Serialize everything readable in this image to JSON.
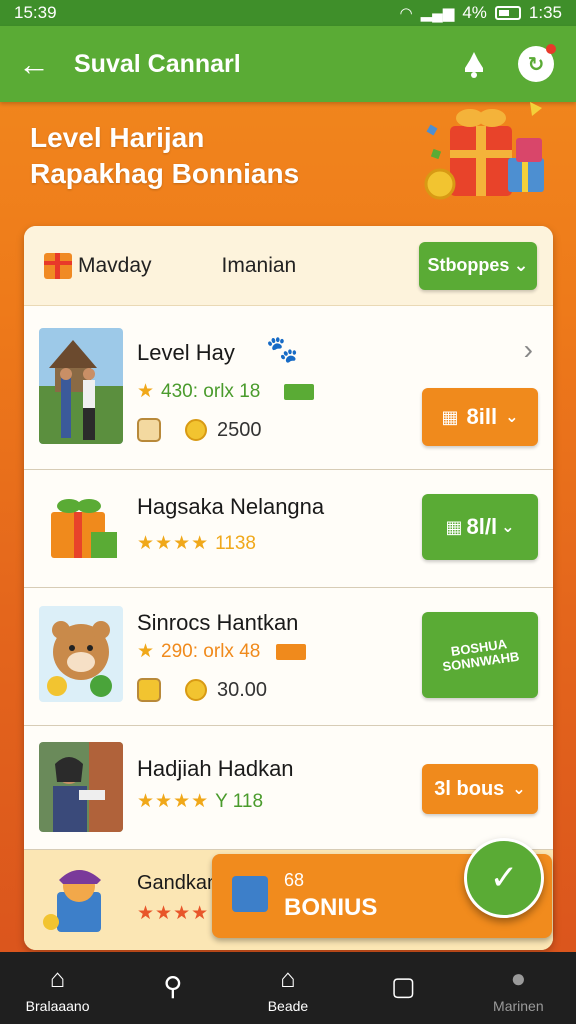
{
  "status": {
    "time": "15:39",
    "battery": "4%",
    "clock": "1:35"
  },
  "appbar": {
    "title": "Suval Cannarl"
  },
  "hero": {
    "line1": "Level Harijan",
    "line2": "Rapakhag Bonnians"
  },
  "card": {
    "tab1": "Mavday",
    "tab2": "Imanian",
    "action": "Stboppes"
  },
  "rows": [
    {
      "name": "Level Hay",
      "meta": "430: orlx 18",
      "value": "2500",
      "button": "8ill"
    },
    {
      "name": "Hagsaka Nelangna",
      "meta": "1138",
      "button": "8l/l"
    },
    {
      "name": "Sinrocs Hantkan",
      "meta": "290: orlx 48",
      "value": "30.00",
      "button": "BOSHUA SONNWAHB"
    },
    {
      "name": "Hadjiah Hadkan",
      "meta": "Y 118",
      "button": "3l bous"
    },
    {
      "name": "Gandkan"
    }
  ],
  "bonus": {
    "top": "68",
    "label": "BONIUS"
  },
  "nav": [
    {
      "label": "Bralaaano",
      "icon": "home-icon"
    },
    {
      "label": "",
      "icon": "search-icon"
    },
    {
      "label": "Beade",
      "icon": "house-outline-icon"
    },
    {
      "label": "",
      "icon": "square-icon"
    },
    {
      "label": "Marinen",
      "icon": "profile-icon"
    }
  ],
  "colors": {
    "primary_green": "#5aab35",
    "accent_orange": "#f08a1c",
    "background": "#ee7a1a"
  }
}
